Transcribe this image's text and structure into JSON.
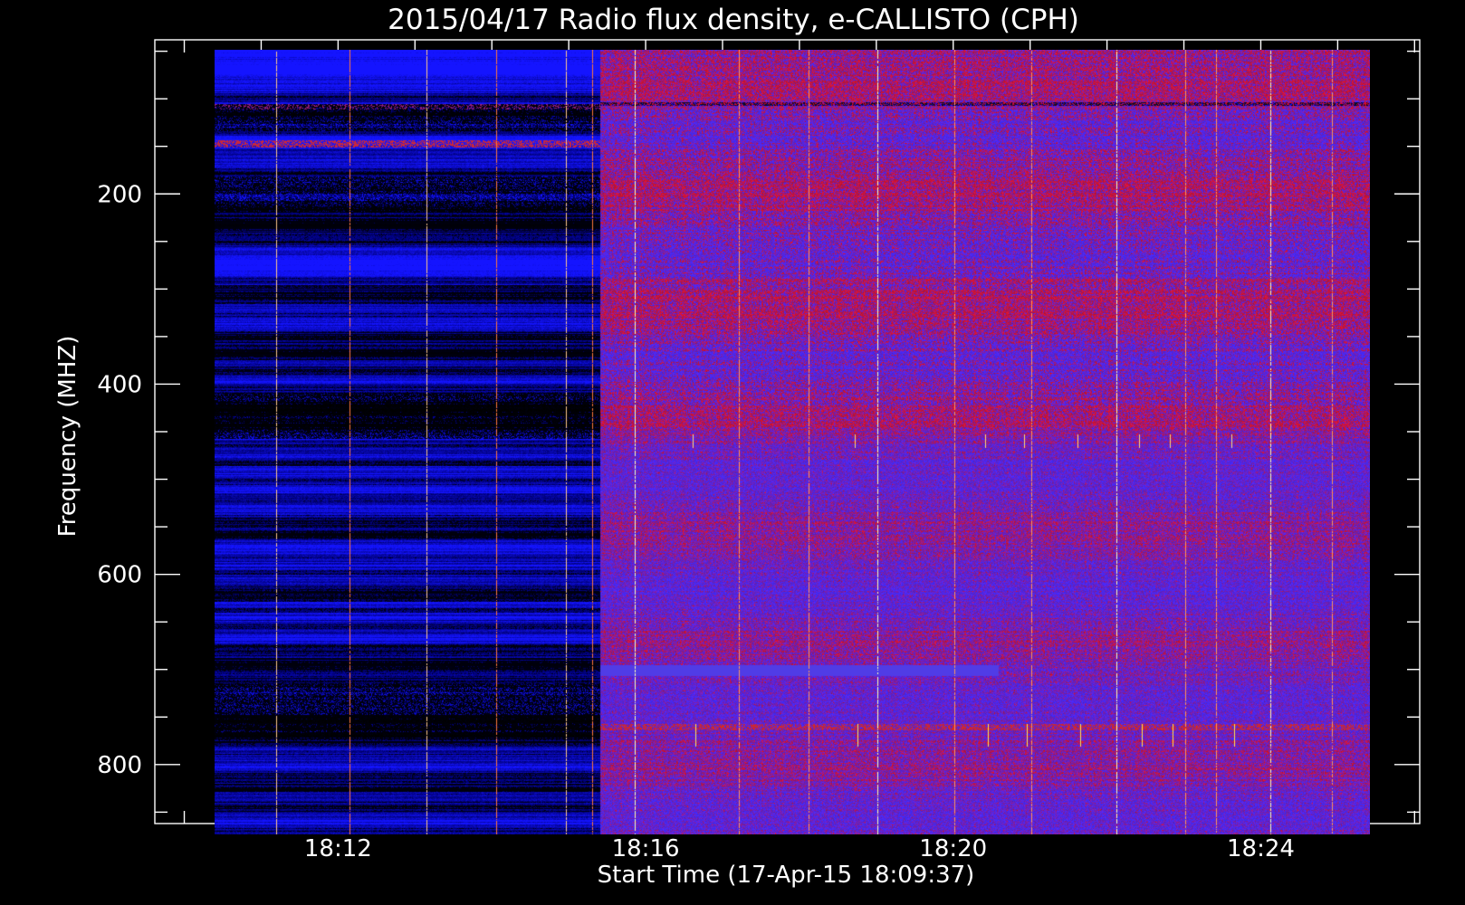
{
  "chart_data": {
    "type": "heatmap",
    "title": "2015/04/17  Radio flux density, e-CALLISTO (CPH)",
    "xlabel": "Start Time (17-Apr-15 18:09:37)",
    "ylabel": "Frequency (MHZ)",
    "x_tick_labels": [
      "18:12",
      "18:16",
      "18:20",
      "18:24"
    ],
    "x_tick_values_min": [
      2.383,
      6.383,
      10.383,
      14.383
    ],
    "y_tick_labels": [
      "200",
      "400",
      "600",
      "800"
    ],
    "y_tick_values": [
      200,
      400,
      600,
      800
    ],
    "xlim_min": [
      0,
      16.45
    ],
    "ylim": [
      862,
      38
    ],
    "y_inverted": true,
    "data_xrange_min": [
      0.78,
      15.8
    ],
    "data_yrange": [
      48,
      873
    ],
    "segments": [
      {
        "name": "before 18:15",
        "start_min": 0.78,
        "end_min": 5.8,
        "dominant_colors": [
          "#000000",
          "#1414e6",
          "#3a3aff"
        ]
      },
      {
        "name": "after 18:15",
        "start_min": 5.8,
        "end_min": 15.8,
        "dominant_colors": [
          "#5a2ad0",
          "#7a1a90",
          "#c01818"
        ]
      }
    ],
    "colors": {
      "background": "#000000",
      "axis": "#ffffff",
      "low": "#0000ff",
      "mid": "#7020a0",
      "high": "#ff2020",
      "peak": "#ffff80"
    }
  }
}
